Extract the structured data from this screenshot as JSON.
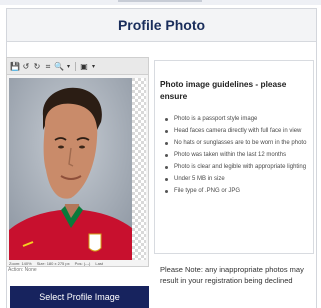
{
  "header": {
    "title": "Profile Photo"
  },
  "editor": {
    "toolbar": {
      "icons": [
        "save-icon",
        "rotate-left-icon",
        "rotate-right-icon",
        "crop-icon",
        "zoom-icon",
        "zoom-dropdown-icon",
        "fit-icon",
        "fit-dropdown-icon"
      ],
      "glyphs": {
        "save": "💾",
        "rotate_left": "↺",
        "rotate_right": "↻",
        "crop": "⌗",
        "zoom": "🔍",
        "fit": "▣",
        "dropdown": "▾"
      }
    },
    "status": {
      "zoom": "Zoom: 140%",
      "size": "Size: 180 x 275 px",
      "pos": "Pos: (---)",
      "last": "Last"
    },
    "action": "Action: None"
  },
  "select_button": {
    "label": "Select Profile Image"
  },
  "guidelines": {
    "title": "Photo image guidelines - please ensure",
    "items": [
      "Photo is a passport style image",
      "Head faces camera directly with full face in view",
      "No hats or sunglasses are to be worn in the photo",
      "Photo was taken within the last 12 months",
      "Photo is clear and legible with appropriate lighting",
      "Under 5 MB in size",
      "File type of .PNG or JPG"
    ]
  },
  "note": "Please Note: any inappropriate photos may result in your registration being declined",
  "colors": {
    "title": "#1a2e5c",
    "button_bg": "#17235e",
    "shirt": "#c8102e",
    "shirt_green": "#0a7a3b"
  }
}
